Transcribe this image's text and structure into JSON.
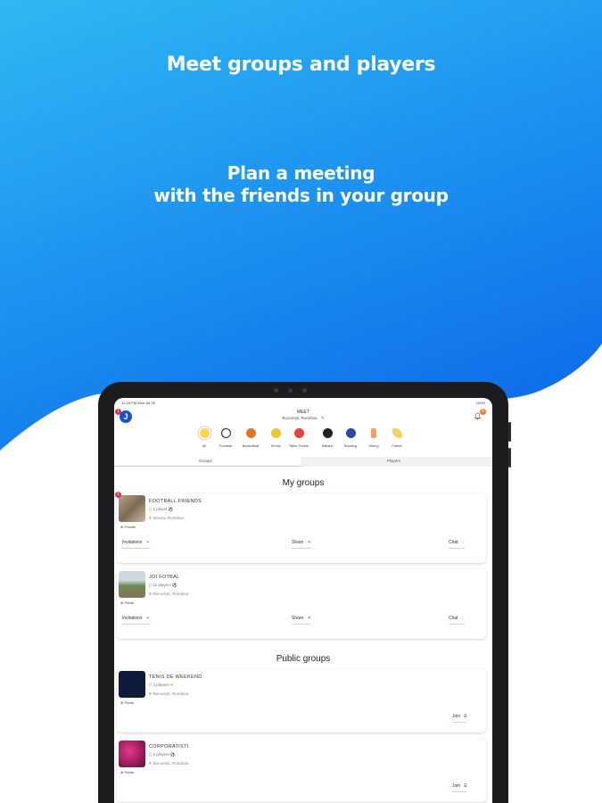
{
  "headline": {
    "line1": "Meet groups and players",
    "line2a": "Plan a meeting",
    "line2b": "with the friends in your group"
  },
  "status_bar": {
    "time": "12:15 PM  Mon Jul 25",
    "battery": "100%"
  },
  "app": {
    "logo_letter": "J",
    "logo_badge": "1",
    "title": "MEET",
    "location": "Bucureşti, România",
    "notif_badge": "8"
  },
  "sports": [
    {
      "name": "All",
      "color": "#ffd64a"
    },
    {
      "name": "Football",
      "color": "#ffffff"
    },
    {
      "name": "Basketball",
      "color": "#d9772b"
    },
    {
      "name": "Tennis",
      "color": "#e9c634"
    },
    {
      "name": "Table Tennis",
      "color": "#e64040"
    },
    {
      "name": "Billiard",
      "color": "#222222"
    },
    {
      "name": "Bowling",
      "color": "#2b4aa0"
    },
    {
      "name": "Hiking",
      "color": "#f0a15a"
    },
    {
      "name": "Futnet",
      "color": "#f1d36a"
    }
  ],
  "tabs": {
    "groups": "Groups",
    "players": "Players"
  },
  "my_groups": {
    "title": "My groups",
    "items": [
      {
        "name": "FOOTBALL FRIENDS",
        "players": "1 player",
        "location": "Brasov, România",
        "privacy": "Private",
        "badge": "1",
        "actions": {
          "invitations": "Invitations",
          "share": "Share",
          "chat": "Chat"
        }
      },
      {
        "name": "JOI FOTBAL",
        "players": "11 players",
        "location": "Bucureşti, România",
        "privacy": "Public",
        "actions": {
          "invitations": "Invitations",
          "share": "Share",
          "chat": "Chat"
        }
      }
    ]
  },
  "public_groups": {
    "title": "Public groups",
    "items": [
      {
        "name": "TENIS DE WEEKEND",
        "players": "3 players",
        "location": "Bucureşti, România",
        "privacy": "Public",
        "join": "Join"
      },
      {
        "name": "CORPORATISTI",
        "players": "2 players",
        "location": "Bucureşti, România",
        "privacy": "Public",
        "join": "Join"
      }
    ]
  },
  "colors": {
    "accent": "#1a4fd6",
    "badge": "#e5304a",
    "bg_top": "#2fb8f3",
    "bg_bottom": "#0650df"
  }
}
